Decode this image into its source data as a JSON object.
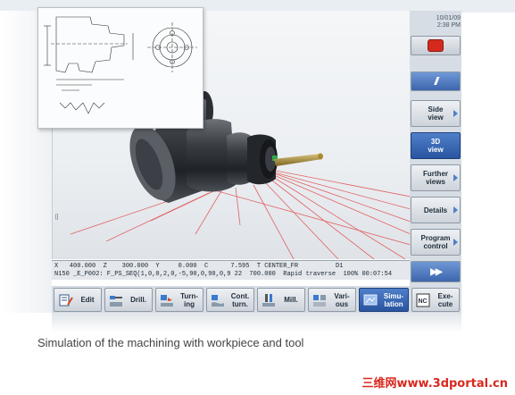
{
  "header": {
    "date": "10/01/09",
    "time": "2:38 PM"
  },
  "right_softkeys": [
    {
      "label": "",
      "icon": "red-stop-icon"
    },
    {
      "label": "//",
      "icon": "slash-icon"
    },
    {
      "label": "Side view"
    },
    {
      "label": "3D view",
      "selected": true
    },
    {
      "label": "Further views"
    },
    {
      "label": "Details"
    },
    {
      "label": "Program control"
    },
    {
      "label": "",
      "icon": "fast-forward-icon"
    }
  ],
  "status": {
    "row1": "X   400.000  Z    300.000  Y     0.000  C      7.595  T CENTER_FR          D1",
    "row2": "N150 _E_P002: F_PS_SEQ(1,0,0,2,0,-5,90,0,90,0,9 22  700.000  Rapid traverse  100% 00:07:54"
  },
  "bottom_softkeys": [
    {
      "label": "Edit",
      "icon": "edit-icon"
    },
    {
      "label": "Drill.",
      "icon": "drill-icon"
    },
    {
      "label": "Turn-\ning",
      "icon": "turning-icon"
    },
    {
      "label": "Cont.\nturn.",
      "icon": "contour-turning-icon"
    },
    {
      "label": "Mill.",
      "icon": "mill-icon"
    },
    {
      "label": "Vari-\nous",
      "icon": "various-icon"
    },
    {
      "label": "Simu-\nlation",
      "icon": "simulation-icon",
      "selected": true
    },
    {
      "label": "Exe-\ncute",
      "icon": "nc-execute-icon"
    }
  ],
  "caption": "Simulation of the machining with workpiece and tool",
  "watermark": "三维网www.3dportal.cn",
  "colors": {
    "selected": "#2a55a0",
    "tool_path": "#e04a4a",
    "watermark": "#d8281e"
  }
}
